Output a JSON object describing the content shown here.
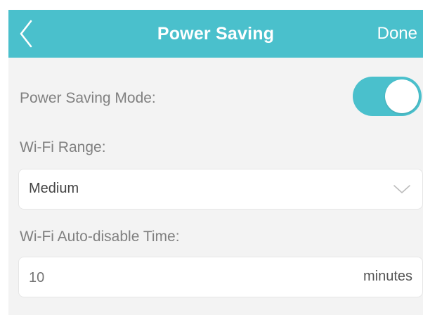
{
  "header": {
    "title": "Power Saving",
    "back_icon": "chevron-left-icon",
    "done_label": "Done",
    "background": "#4ac0cc"
  },
  "power_saving_mode": {
    "label": "Power Saving Mode:",
    "enabled": true,
    "toggle_color": "#4ac0cc"
  },
  "wifi_range": {
    "label": "Wi-Fi Range:",
    "selected": "Medium",
    "dropdown_icon": "chevron-down-icon"
  },
  "auto_disable": {
    "label": "Wi-Fi Auto-disable Time:",
    "value": "",
    "placeholder": "10",
    "unit": "minutes"
  }
}
